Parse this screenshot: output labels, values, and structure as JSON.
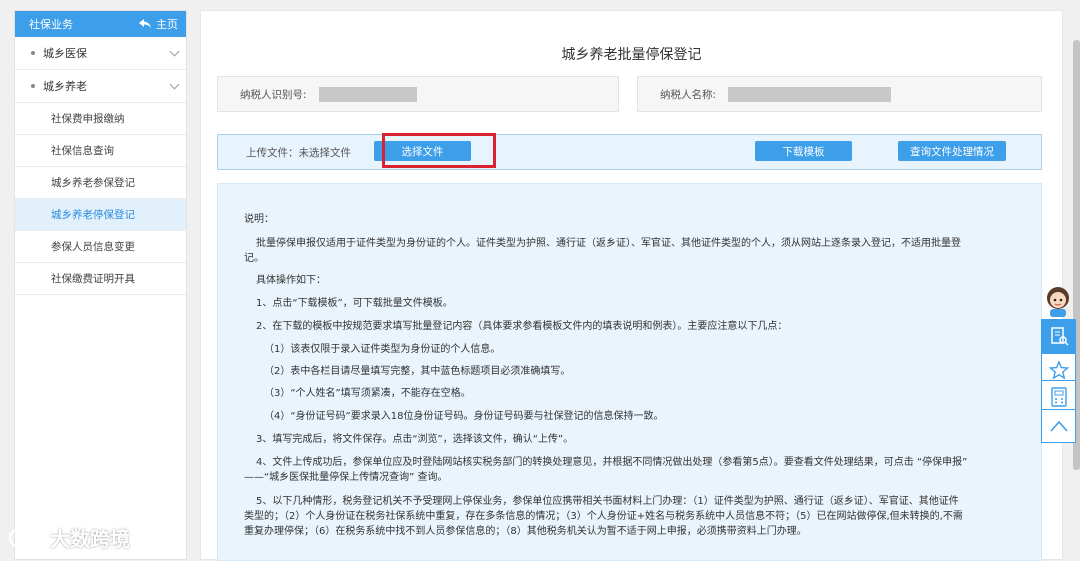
{
  "sidebar": {
    "title": "社保业务",
    "home_label": "主页",
    "groups": [
      {
        "label": "城乡医保"
      },
      {
        "label": "城乡养老"
      }
    ],
    "items": [
      {
        "label": "社保费申报缴纳"
      },
      {
        "label": "社保信息查询"
      },
      {
        "label": "城乡养老参保登记"
      },
      {
        "label": "城乡养老停保登记"
      },
      {
        "label": "参保人员信息变更"
      },
      {
        "label": "社保缴费证明开具"
      }
    ]
  },
  "main": {
    "title": "城乡养老批量停保登记",
    "taxpayer_id_label": "纳税人识别号:",
    "taxpayer_name_label": "纳税人名称:",
    "upload_label": "上传文件：未选择文件",
    "choose_file_label": "选择文件",
    "download_template_label": "下载模板",
    "query_status_label": "查询文件处理情况",
    "instructions": [
      "说明：",
      "批量停保申报仅适用于证件类型为身份证的个人。证件类型为护照、通行证（返乡证）、军官证、其他证件类型的个人，须从网站上逐条录入登记，不适用批量登",
      "记。",
      "具体操作如下：",
      "1、点击“下载模板”，可下载批量文件模板。",
      "2、在下载的模板中按规范要求填写批量登记内容（具体要求参看模板文件内的填表说明和例表）。主要应注意以下几点：",
      "（1）该表仅限于录入证件类型为身份证的个人信息。",
      "（2）表中各栏目请尽量填写完整，其中蓝色标题项目必须准确填写。",
      "（3）“个人姓名”填写须紧凑，不能存在空格。",
      "（4）“身份证号码”要求录入18位身份证号码。身份证号码要与社保登记的信息保持一致。",
      "3、填写完成后，将文件保存。点击“浏览”，选择该文件，确认“上传”。",
      "4、文件上传成功后，参保单位应及时登陆网站核实税务部门的转换处理意见，并根据不同情况做出处理（参看第5点）。要查看文件处理结果，可点击 “停保申报”",
      "——“城乡医保批量停保上传情况查询” 查询。",
      "5、以下几种情形，税务登记机关不予受理网上停保业务，参保单位应携带相关书面材料上门办理：（1）证件类型为护照、通行证（返乡证）、军官证、其他证件",
      "类型的；（2）个人身份证在税务社保系统中重复，存在多条信息的情况；（3）个人身份证+姓名与税务系统中人员信息不符；（5）已在网站做停保,但未转换的,不需",
      "重复办理停保；（6）在税务系统中找不到人员参保信息的；（8）其他税务机关认为暂不适于网上申报，必须携带资料上门办理。"
    ]
  },
  "watermark": "大数跨境",
  "colors": {
    "accent": "#3d9ee9",
    "highlight": "#d9232e"
  }
}
